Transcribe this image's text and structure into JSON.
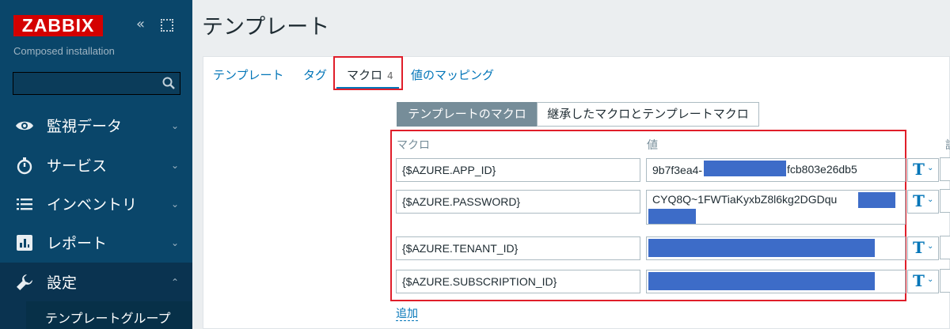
{
  "sidebar": {
    "logo": "ZABBIX",
    "installation": "Composed installation",
    "search_placeholder": "",
    "menu": [
      {
        "label": "監視データ",
        "icon": "eye-icon"
      },
      {
        "label": "サービス",
        "icon": "stopwatch-icon"
      },
      {
        "label": "インベントリ",
        "icon": "list-icon"
      },
      {
        "label": "レポート",
        "icon": "bar-chart-icon"
      },
      {
        "label": "設定",
        "icon": "wrench-icon"
      }
    ],
    "submenu": [
      {
        "label": "テンプレートグループ"
      }
    ]
  },
  "page": {
    "title": "テンプレート"
  },
  "tabs": [
    {
      "label": "テンプレート"
    },
    {
      "label": "タグ"
    },
    {
      "label": "マクロ",
      "count": "4"
    },
    {
      "label": "値のマッピング"
    }
  ],
  "macro_view": {
    "segments": [
      "テンプレートのマクロ",
      "継承したマクロとテンプレートマクロ"
    ],
    "columns": {
      "macro": "マクロ",
      "value": "値",
      "description": "説"
    },
    "rows": [
      {
        "macro": "{$AZURE.APP_ID}",
        "value_start": "9b7f3ea4-",
        "value_end": "fcb803e26db5"
      },
      {
        "macro": "{$AZURE.PASSWORD}",
        "value_start": "CYQ8Q~1FWTiaKyxbZ8l6kg2DGDqu",
        "value_end": ""
      },
      {
        "macro": "{$AZURE.TENANT_ID}",
        "value_start": "",
        "value_end": ""
      },
      {
        "macro": "{$AZURE.SUBSCRIPTION_ID}",
        "value_start": "",
        "value_end": ""
      }
    ],
    "value_type_glyph": "T",
    "add_label": "追加"
  },
  "colors": {
    "sidebar_bg": "#0a466a",
    "brand_red": "#d40000",
    "link_blue": "#0275b8",
    "highlight_red": "#e01e2a",
    "redaction_blue": "#3d6cc8"
  }
}
